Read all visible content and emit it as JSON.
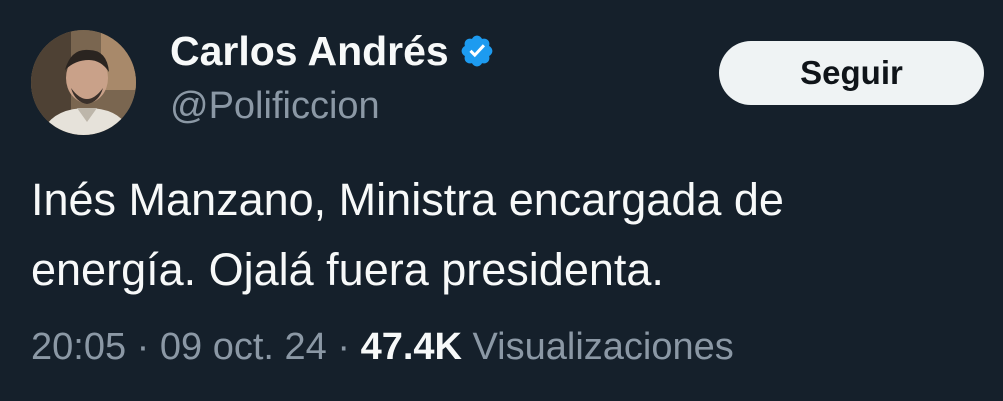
{
  "author": {
    "display_name": "Carlos Andrés",
    "handle": "@Polificcion",
    "verified_icon": "verified-badge-icon"
  },
  "follow_button": {
    "label": "Seguir"
  },
  "tweet": {
    "lines": [
      "Inés Manzano, Ministra encargada de",
      "energía. Ojalá fuera presidenta."
    ]
  },
  "meta": {
    "time": "20:05",
    "separator1": " · ",
    "date": "09 oct. 24",
    "separator2": " · ",
    "views_count": "47.4K",
    "views_label": " Visualizaciones"
  },
  "colors": {
    "background": "#15202b",
    "primary_text": "#f7f9f9",
    "secondary_text": "#8b98a5",
    "verified_blue": "#1d9bf0",
    "button_bg": "#eff3f4"
  }
}
